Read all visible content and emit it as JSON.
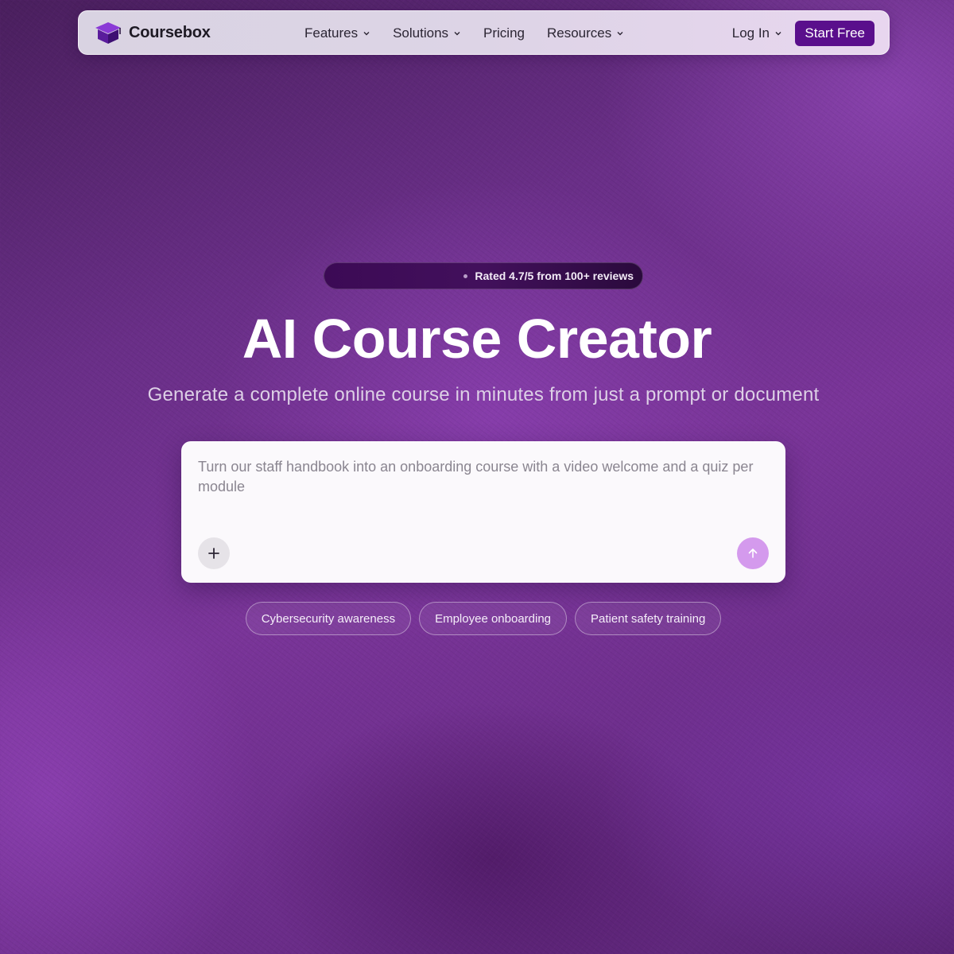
{
  "brand": {
    "name": "Coursebox"
  },
  "nav": {
    "items": [
      {
        "label": "Features",
        "dropdown": true
      },
      {
        "label": "Solutions",
        "dropdown": true
      },
      {
        "label": "Pricing",
        "dropdown": false
      },
      {
        "label": "Resources",
        "dropdown": true
      }
    ],
    "login_label": "Log In",
    "cta_label": "Start Free"
  },
  "rating": {
    "text": "Rated 4.7/5 from 100+ reviews"
  },
  "hero": {
    "title": "AI Course Creator",
    "subtitle": "Generate a complete online course in minutes from just a prompt or document"
  },
  "prompt": {
    "placeholder": "Turn our staff handbook into an onboarding course with a video welcome and a quiz per module",
    "value": ""
  },
  "suggestions": [
    "Cybersecurity awareness",
    "Employee onboarding",
    "Patient safety training"
  ],
  "icons": {
    "logo": "graduation-cap-cube-icon",
    "chevron": "chevron-down-icon",
    "add": "plus-icon",
    "send": "arrow-up-icon"
  },
  "colors": {
    "accent": "#5a0f8c",
    "send_button": "#d49aed",
    "background": "#6a2f88"
  }
}
